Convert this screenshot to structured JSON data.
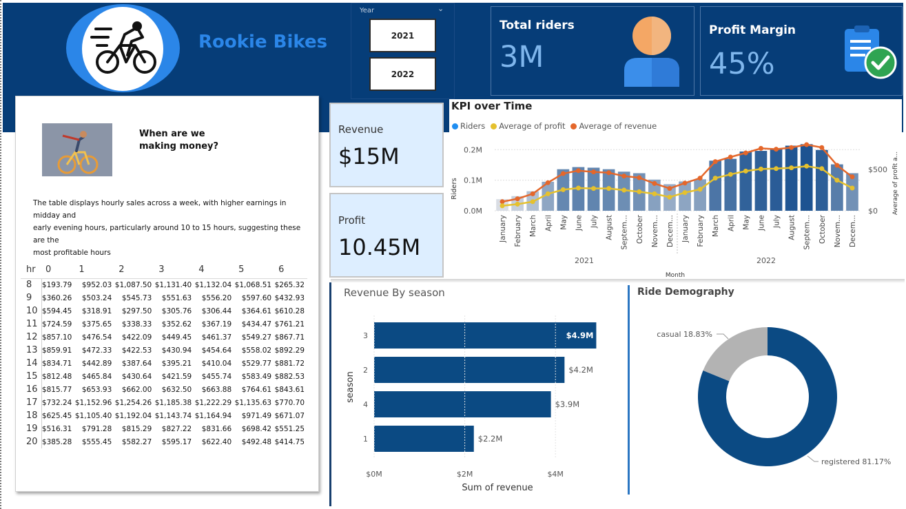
{
  "brand": {
    "name": "Rookie Bikes"
  },
  "year_slicer": {
    "title": "Year",
    "options": [
      "2021",
      "2022"
    ]
  },
  "kpis": {
    "total_riders": {
      "title": "Total riders",
      "value": "3M"
    },
    "profit_margin": {
      "title": "Profit Margin",
      "value": "45%"
    },
    "revenue": {
      "label": "Revenue",
      "value": "$15M"
    },
    "profit": {
      "label": "Profit",
      "value": "10.45M"
    }
  },
  "hourly_panel": {
    "question_line1": "When are we",
    "question_line2": "making money?",
    "description_line1": "The table displays hourly sales across a week, with higher earnings in midday and",
    "description_line2": "early evening hours, particularly  around 10 to 15 hours, suggesting these are the",
    "description_line3": "most profitable hours",
    "table": {
      "corner": "hr",
      "columns": [
        "0",
        "1",
        "2",
        "3",
        "4",
        "5",
        "6"
      ],
      "rows": [
        {
          "hr": "8",
          "cells": [
            "$193.79",
            "$952.03",
            "$1,087.50",
            "$1,131.40",
            "$1,132.04",
            "$1,068.51",
            "$265.32"
          ]
        },
        {
          "hr": "9",
          "cells": [
            "$360.26",
            "$503.24",
            "$545.73",
            "$551.63",
            "$556.20",
            "$597.60",
            "$432.93"
          ]
        },
        {
          "hr": "10",
          "cells": [
            "$594.45",
            "$318.91",
            "$297.50",
            "$305.76",
            "$306.44",
            "$364.61",
            "$610.28"
          ]
        },
        {
          "hr": "11",
          "cells": [
            "$724.59",
            "$375.65",
            "$338.33",
            "$352.62",
            "$367.19",
            "$434.47",
            "$761.21"
          ]
        },
        {
          "hr": "12",
          "cells": [
            "$857.10",
            "$476.54",
            "$422.09",
            "$449.45",
            "$461.37",
            "$549.27",
            "$867.71"
          ]
        },
        {
          "hr": "13",
          "cells": [
            "$859.91",
            "$472.33",
            "$422.53",
            "$430.94",
            "$454.64",
            "$558.02",
            "$892.29"
          ]
        },
        {
          "hr": "14",
          "cells": [
            "$834.71",
            "$442.89",
            "$387.64",
            "$395.21",
            "$410.04",
            "$529.77",
            "$881.72"
          ]
        },
        {
          "hr": "15",
          "cells": [
            "$812.48",
            "$465.84",
            "$430.64",
            "$421.59",
            "$455.74",
            "$583.49",
            "$882.53"
          ]
        },
        {
          "hr": "16",
          "cells": [
            "$815.77",
            "$653.93",
            "$662.00",
            "$632.50",
            "$663.88",
            "$764.61",
            "$843.61"
          ]
        },
        {
          "hr": "17",
          "cells": [
            "$732.24",
            "$1,152.96",
            "$1,254.26",
            "$1,185.38",
            "$1,222.29",
            "$1,135.63",
            "$770.70"
          ]
        },
        {
          "hr": "18",
          "cells": [
            "$625.45",
            "$1,105.40",
            "$1,192.04",
            "$1,143.74",
            "$1,164.94",
            "$971.49",
            "$671.07"
          ]
        },
        {
          "hr": "19",
          "cells": [
            "$516.31",
            "$791.28",
            "$815.29",
            "$827.22",
            "$831.66",
            "$698.42",
            "$551.25"
          ]
        },
        {
          "hr": "20",
          "cells": [
            "$385.28",
            "$555.45",
            "$582.27",
            "$595.17",
            "$622.40",
            "$492.48",
            "$414.75"
          ]
        }
      ]
    }
  },
  "kpi_chart": {
    "title": "KPI over Time",
    "legend": [
      {
        "label": "Riders",
        "color": "#1f8ef1"
      },
      {
        "label": "Average of profit",
        "color": "#e5c12e"
      },
      {
        "label": "Average of revenue",
        "color": "#e4672b"
      }
    ],
    "y_axis_label": "Riders",
    "y2_axis_label": "Average of profit a...",
    "x_axis_label": "Month",
    "y_ticks": [
      "0.0M",
      "0.1M",
      "0.2M"
    ],
    "y2_ticks": [
      "$0",
      "$500"
    ],
    "year_labels": [
      "2021",
      "2022"
    ],
    "month_labels": [
      "January",
      "February",
      "March",
      "April",
      "May",
      "June",
      "July",
      "August",
      "Septem...",
      "October",
      "Novem...",
      "Decem...",
      "January",
      "February",
      "March",
      "April",
      "May",
      "June",
      "July",
      "August",
      "Septem...",
      "October",
      "Novem...",
      "Decem..."
    ]
  },
  "chart_data": [
    {
      "type": "bar",
      "title": "KPI over Time",
      "xlabel": "Month",
      "ylabel": "Riders",
      "y2label": "Average of profit a...",
      "categories": [
        "January 2021",
        "February 2021",
        "March 2021",
        "April 2021",
        "May 2021",
        "June 2021",
        "July 2021",
        "August 2021",
        "September 2021",
        "October 2021",
        "November 2021",
        "December 2021",
        "January 2022",
        "February 2022",
        "March 2022",
        "April 2022",
        "May 2022",
        "June 2022",
        "July 2022",
        "August 2022",
        "September 2022",
        "October 2022",
        "November 2022",
        "December 2022"
      ],
      "series": [
        {
          "name": "Riders",
          "type": "bar",
          "axis": "y",
          "values": [
            38000,
            48000,
            64000,
            95000,
            136000,
            143000,
            141000,
            136000,
            128000,
            123000,
            102000,
            87000,
            96000,
            103000,
            164000,
            170000,
            194000,
            196000,
            203000,
            213000,
            218000,
            199000,
            152000,
            123000
          ]
        },
        {
          "name": "Average of profit",
          "type": "line",
          "axis": "y2",
          "values": [
            60,
            80,
            110,
            205,
            255,
            275,
            270,
            270,
            250,
            230,
            205,
            165,
            220,
            260,
            395,
            440,
            480,
            505,
            510,
            520,
            540,
            510,
            370,
            275
          ]
        },
        {
          "name": "Average of revenue",
          "type": "line",
          "axis": "y2",
          "values": [
            110,
            145,
            205,
            340,
            450,
            485,
            470,
            460,
            420,
            400,
            330,
            270,
            335,
            395,
            595,
            650,
            700,
            755,
            745,
            765,
            800,
            765,
            550,
            410
          ]
        }
      ],
      "ylim": [
        0,
        230000
      ],
      "y2lim": [
        0,
        850
      ],
      "year_groups": [
        "2021",
        "2022"
      ]
    },
    {
      "type": "bar",
      "orientation": "horizontal",
      "title": "Revenue By season",
      "xlabel": "Sum of revenue",
      "ylabel": "season",
      "categories": [
        "3",
        "2",
        "4",
        "1"
      ],
      "values": [
        4.9,
        4.2,
        3.9,
        2.2
      ],
      "value_labels": [
        "$4.9M",
        "$4.2M",
        "$3.9M",
        "$2.2M"
      ],
      "x_ticks": [
        "$0M",
        "$2M",
        "$4M"
      ],
      "xlim": [
        0,
        5
      ]
    },
    {
      "type": "pie",
      "variant": "donut",
      "title": "Ride Demography",
      "labels": [
        "casual",
        "registered"
      ],
      "values": [
        18.83,
        81.17
      ],
      "slice_labels": [
        "casual 18.83%",
        "registered 81.17%"
      ],
      "colors": [
        "#b3b3b3",
        "#0b4a83"
      ]
    }
  ],
  "colors": {
    "header_bg": "#063d78",
    "brand_blue": "#2b86e8",
    "bar_dark": "#1d5391",
    "bar_light": "#d9dde4",
    "card_bg": "#ddeeff"
  }
}
